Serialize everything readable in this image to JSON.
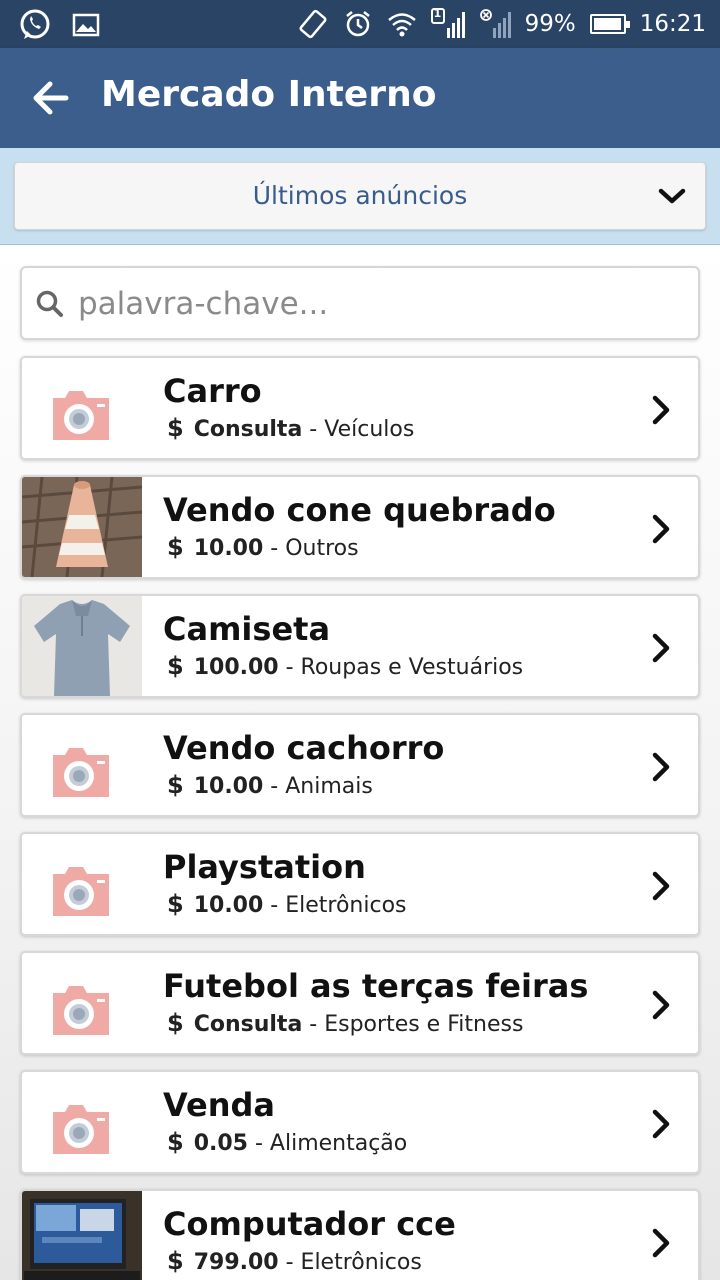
{
  "status_bar": {
    "battery": "99%",
    "battery_level": 0.99,
    "time": "16:21",
    "sim_badge": "1",
    "icons": [
      "whatsapp-icon",
      "gallery-icon",
      "screen-rotate-icon",
      "alarm-icon",
      "wifi-icon",
      "signal-icon",
      "no-signal-icon",
      "battery-icon"
    ]
  },
  "app_bar": {
    "title": "Mercado Interno",
    "back_icon": "arrow-left-icon"
  },
  "filter": {
    "selected": "Últimos anúncios",
    "icon": "chevron-down-icon"
  },
  "search": {
    "placeholder": "palavra-chave...",
    "value": "",
    "icon": "search-icon"
  },
  "listings": [
    {
      "title": "Carro",
      "currency": "$",
      "price": "Consulta",
      "category": "Veículos",
      "thumb": "camera-placeholder"
    },
    {
      "title": "Vendo cone quebrado",
      "currency": "$",
      "price": "10.00",
      "category": "Outros",
      "thumb": "photo-cone"
    },
    {
      "title": "Camiseta",
      "currency": "$",
      "price": "100.00",
      "category": "Roupas e Vestuários",
      "thumb": "photo-shirt"
    },
    {
      "title": "Vendo cachorro",
      "currency": "$",
      "price": "10.00",
      "category": "Animais",
      "thumb": "camera-placeholder"
    },
    {
      "title": "Playstation",
      "currency": "$",
      "price": "10.00",
      "category": "Eletrônicos",
      "thumb": "camera-placeholder"
    },
    {
      "title": "Futebol as terças feiras",
      "currency": "$",
      "price": "Consulta",
      "category": "Esportes e Fitness",
      "thumb": "camera-placeholder"
    },
    {
      "title": "Venda",
      "currency": "$",
      "price": "0.05",
      "category": "Alimentação",
      "thumb": "camera-placeholder"
    },
    {
      "title": "Computador cce",
      "currency": "$",
      "price": "799.00",
      "category": "Eletrônicos",
      "thumb": "photo-laptop"
    }
  ],
  "colors": {
    "status_bar": "#2a4466",
    "app_bar": "#3b5e8c",
    "filter_bg": "#c8dff0",
    "filter_text": "#3a5c8c",
    "placeholder_camera": "#f0aaa5"
  }
}
